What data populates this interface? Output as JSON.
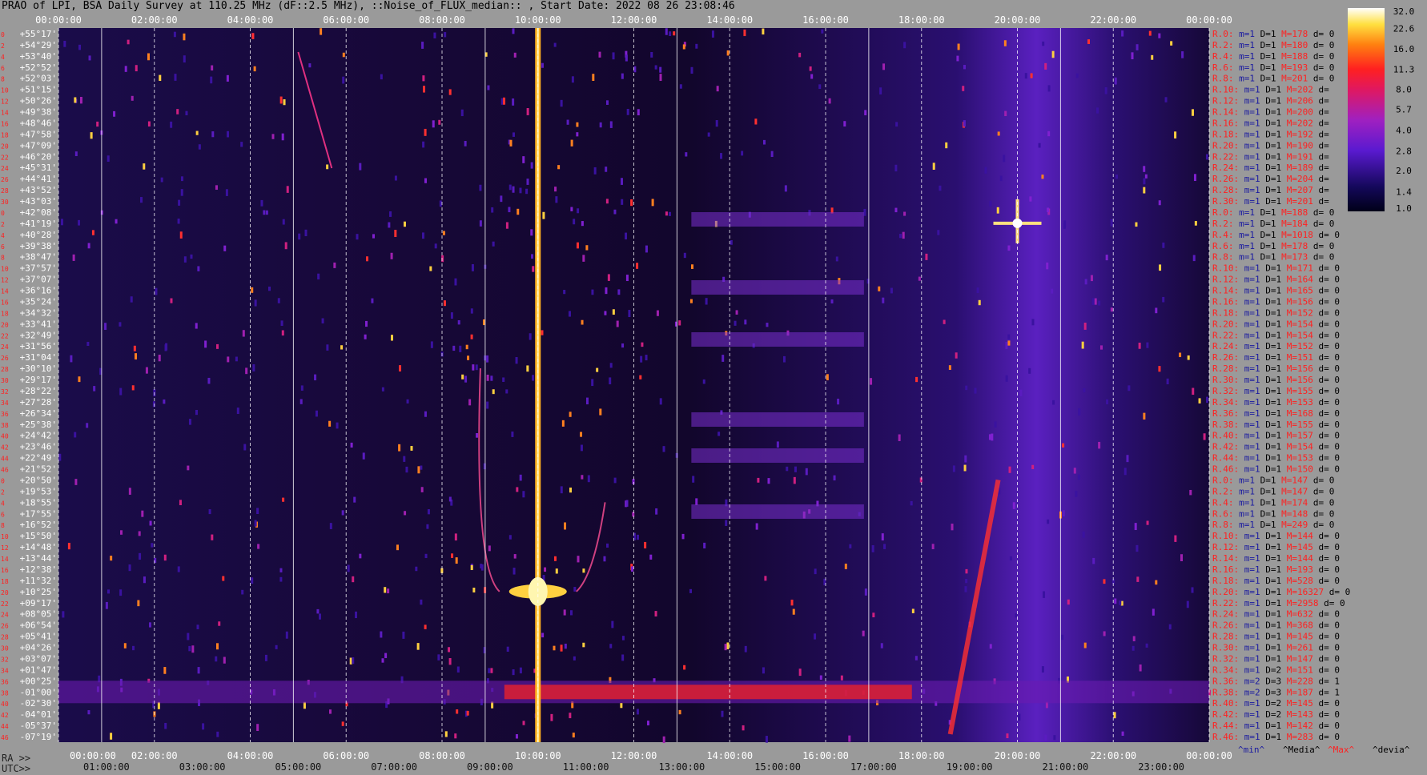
{
  "title": "PRAO of LPI, BSA Daily Survey at 110.25 MHz (dF::2.5 MHz), ::Noise_of_FLUX_median:: , Start Date: 2022 08 26 23:08:46",
  "footer": {
    "ra_label": "RA >>",
    "utc_label": "UTC>>"
  },
  "colors": {
    "background": "#9a9a9a",
    "plot_bg": "#1a0a40",
    "signal": "#ffd040",
    "label_red": "#ff2020",
    "label_blue": "#1a1aa0"
  },
  "chart_data": {
    "type": "heatmap",
    "title": "PRAO of LPI, BSA Daily Survey at 110.25 MHz (dF::2.5 MHz), ::Noise_of_FLUX_median:: , Start Date: 2022 08 26 23:08:46",
    "x_top_ticks": [
      "00:00:00",
      "02:00:00",
      "04:00:00",
      "06:00:00",
      "08:00:00",
      "10:00:00",
      "12:00:00",
      "14:00:00",
      "16:00:00",
      "18:00:00",
      "20:00:00",
      "22:00:00",
      "00:00:00"
    ],
    "x_bottom_ra_ticks": [
      "00:00:00",
      "02:00:00",
      "04:00:00",
      "06:00:00",
      "08:00:00",
      "10:00:00",
      "12:00:00",
      "14:00:00",
      "16:00:00",
      "18:00:00",
      "20:00:00",
      "22:00:00",
      "00:00:00"
    ],
    "x_bottom_utc_ticks": [
      "01:00:00",
      "03:00:00",
      "05:00:00",
      "07:00:00",
      "09:00:00",
      "11:00:00",
      "13:00:00",
      "15:00:00",
      "17:00:00",
      "19:00:00",
      "21:00:00",
      "23:00:00"
    ],
    "dec_labels": [
      "+55°17'",
      "+54°29'",
      "+53°40'",
      "+52°52'",
      "+52°03'",
      "+51°15'",
      "+50°26'",
      "+49°38'",
      "+48°46'",
      "+47°58'",
      "+47°09'",
      "+46°20'",
      "+45°31'",
      "+44°41'",
      "+43°52'",
      "+43°03'",
      "+42°08'",
      "+41°19'",
      "+40°28'",
      "+39°38'",
      "+38°47'",
      "+37°57'",
      "+37°07'",
      "+36°16'",
      "+35°24'",
      "+34°32'",
      "+33°41'",
      "+32°49'",
      "+31°56'",
      "+31°04'",
      "+30°10'",
      "+29°17'",
      "+28°22'",
      "+27°28'",
      "+26°34'",
      "+25°38'",
      "+24°42'",
      "+23°46'",
      "+22°49'",
      "+21°52'",
      "+20°50'",
      "+19°53'",
      "+18°55'",
      "+17°55'",
      "+16°52'",
      "+15°50'",
      "+14°48'",
      "+13°44'",
      "+12°38'",
      "+11°32'",
      "+10°25'",
      "+09°17'",
      "+08°05'",
      "+06°54'",
      "+05°41'",
      "+04°26'",
      "+03°07'",
      "+01°47'",
      "+00°25'",
      "-01°00'",
      "-02°30'",
      "-04°01'",
      "-05°37'",
      "-07°19'"
    ],
    "row_index_labels": [
      "0",
      "2",
      "4",
      "6",
      "8",
      "10",
      "12",
      "14",
      "16",
      "18",
      "20",
      "22",
      "24",
      "26",
      "28",
      "30",
      "0",
      "2",
      "4",
      "6",
      "8",
      "10",
      "12",
      "14",
      "16",
      "18",
      "20",
      "22",
      "24",
      "26",
      "28",
      "30",
      "32",
      "34",
      "36",
      "38",
      "40",
      "42",
      "44",
      "46",
      "0",
      "2",
      "4",
      "6",
      "8",
      "10",
      "12",
      "14",
      "16",
      "18",
      "20",
      "22",
      "24",
      "26",
      "28",
      "30",
      "32",
      "34",
      "36",
      "38",
      "40",
      "42",
      "44",
      "46"
    ],
    "row_stats": [
      {
        "r": "R.0:",
        "m": "m=1",
        "d": "D=1",
        "M": "M=178",
        "dv": "d= 0"
      },
      {
        "r": "R.2:",
        "m": "m=1",
        "d": "D=1",
        "M": "M=180",
        "dv": "d= 0"
      },
      {
        "r": "R.4:",
        "m": "m=1",
        "d": "D=1",
        "M": "M=188",
        "dv": "d= 0"
      },
      {
        "r": "R.6:",
        "m": "m=1",
        "d": "D=1",
        "M": "M=193",
        "dv": "d= 0"
      },
      {
        "r": "R.8:",
        "m": "m=1",
        "d": "D=1",
        "M": "M=201",
        "dv": "d= 0"
      },
      {
        "r": "R.10:",
        "m": "m=1",
        "d": "D=1",
        "M": "M=202",
        "dv": "d="
      },
      {
        "r": "R.12:",
        "m": "m=1",
        "d": "D=1",
        "M": "M=206",
        "dv": "d="
      },
      {
        "r": "R.14:",
        "m": "m=1",
        "d": "D=1",
        "M": "M=200",
        "dv": "d="
      },
      {
        "r": "R.16:",
        "m": "m=1",
        "d": "D=1",
        "M": "M=202",
        "dv": "d="
      },
      {
        "r": "R.18:",
        "m": "m=1",
        "d": "D=1",
        "M": "M=192",
        "dv": "d="
      },
      {
        "r": "R.20:",
        "m": "m=1",
        "d": "D=1",
        "M": "M=190",
        "dv": "d="
      },
      {
        "r": "R.22:",
        "m": "m=1",
        "d": "D=1",
        "M": "M=191",
        "dv": "d="
      },
      {
        "r": "R.24:",
        "m": "m=1",
        "d": "D=1",
        "M": "M=189",
        "dv": "d="
      },
      {
        "r": "R.26:",
        "m": "m=1",
        "d": "D=1",
        "M": "M=204",
        "dv": "d="
      },
      {
        "r": "R.28:",
        "m": "m=1",
        "d": "D=1",
        "M": "M=207",
        "dv": "d="
      },
      {
        "r": "R.30:",
        "m": "m=1",
        "d": "D=1",
        "M": "M=201",
        "dv": "d="
      },
      {
        "r": "R.0:",
        "m": "m=1",
        "d": "D=1",
        "M": "M=188",
        "dv": "d= 0"
      },
      {
        "r": "R.2:",
        "m": "m=1",
        "d": "D=1",
        "M": "M=184",
        "dv": "d= 0"
      },
      {
        "r": "R.4:",
        "m": "m=1",
        "d": "D=1",
        "M": "M=1018",
        "dv": "d= 0"
      },
      {
        "r": "R.6:",
        "m": "m=1",
        "d": "D=1",
        "M": "M=178",
        "dv": "d= 0"
      },
      {
        "r": "R.8:",
        "m": "m=1",
        "d": "D=1",
        "M": "M=173",
        "dv": "d= 0"
      },
      {
        "r": "R.10:",
        "m": "m=1",
        "d": "D=1",
        "M": "M=171",
        "dv": "d= 0"
      },
      {
        "r": "R.12:",
        "m": "m=1",
        "d": "D=1",
        "M": "M=164",
        "dv": "d= 0"
      },
      {
        "r": "R.14:",
        "m": "m=1",
        "d": "D=1",
        "M": "M=165",
        "dv": "d= 0"
      },
      {
        "r": "R.16:",
        "m": "m=1",
        "d": "D=1",
        "M": "M=156",
        "dv": "d= 0"
      },
      {
        "r": "R.18:",
        "m": "m=1",
        "d": "D=1",
        "M": "M=152",
        "dv": "d= 0"
      },
      {
        "r": "R.20:",
        "m": "m=1",
        "d": "D=1",
        "M": "M=154",
        "dv": "d= 0"
      },
      {
        "r": "R.22:",
        "m": "m=1",
        "d": "D=1",
        "M": "M=154",
        "dv": "d= 0"
      },
      {
        "r": "R.24:",
        "m": "m=1",
        "d": "D=1",
        "M": "M=152",
        "dv": "d= 0"
      },
      {
        "r": "R.26:",
        "m": "m=1",
        "d": "D=1",
        "M": "M=151",
        "dv": "d= 0"
      },
      {
        "r": "R.28:",
        "m": "m=1",
        "d": "D=1",
        "M": "M=156",
        "dv": "d= 0"
      },
      {
        "r": "R.30:",
        "m": "m=1",
        "d": "D=1",
        "M": "M=156",
        "dv": "d= 0"
      },
      {
        "r": "R.32:",
        "m": "m=1",
        "d": "D=1",
        "M": "M=155",
        "dv": "d= 0"
      },
      {
        "r": "R.34:",
        "m": "m=1",
        "d": "D=1",
        "M": "M=153",
        "dv": "d= 0"
      },
      {
        "r": "R.36:",
        "m": "m=1",
        "d": "D=1",
        "M": "M=168",
        "dv": "d= 0"
      },
      {
        "r": "R.38:",
        "m": "m=1",
        "d": "D=1",
        "M": "M=155",
        "dv": "d= 0"
      },
      {
        "r": "R.40:",
        "m": "m=1",
        "d": "D=1",
        "M": "M=157",
        "dv": "d= 0"
      },
      {
        "r": "R.42:",
        "m": "m=1",
        "d": "D=1",
        "M": "M=154",
        "dv": "d= 0"
      },
      {
        "r": "R.44:",
        "m": "m=1",
        "d": "D=1",
        "M": "M=153",
        "dv": "d= 0"
      },
      {
        "r": "R.46:",
        "m": "m=1",
        "d": "D=1",
        "M": "M=150",
        "dv": "d= 0"
      },
      {
        "r": "R.0:",
        "m": "m=1",
        "d": "D=1",
        "M": "M=147",
        "dv": "d= 0"
      },
      {
        "r": "R.2:",
        "m": "m=1",
        "d": "D=1",
        "M": "M=147",
        "dv": "d= 0"
      },
      {
        "r": "R.4:",
        "m": "m=1",
        "d": "D=1",
        "M": "M=174",
        "dv": "d= 0"
      },
      {
        "r": "R.6:",
        "m": "m=1",
        "d": "D=1",
        "M": "M=148",
        "dv": "d= 0"
      },
      {
        "r": "R.8:",
        "m": "m=1",
        "d": "D=1",
        "M": "M=249",
        "dv": "d= 0"
      },
      {
        "r": "R.10:",
        "m": "m=1",
        "d": "D=1",
        "M": "M=144",
        "dv": "d= 0"
      },
      {
        "r": "R.12:",
        "m": "m=1",
        "d": "D=1",
        "M": "M=145",
        "dv": "d= 0"
      },
      {
        "r": "R.14:",
        "m": "m=1",
        "d": "D=1",
        "M": "M=144",
        "dv": "d= 0"
      },
      {
        "r": "R.16:",
        "m": "m=1",
        "d": "D=1",
        "M": "M=193",
        "dv": "d= 0"
      },
      {
        "r": "R.18:",
        "m": "m=1",
        "d": "D=1",
        "M": "M=528",
        "dv": "d= 0"
      },
      {
        "r": "R.20:",
        "m": "m=1",
        "d": "D=1",
        "M": "M=16327",
        "dv": "d= 0"
      },
      {
        "r": "R.22:",
        "m": "m=1",
        "d": "D=1",
        "M": "M=2958",
        "dv": "d= 0"
      },
      {
        "r": "R.24:",
        "m": "m=1",
        "d": "D=1",
        "M": "M=632",
        "dv": "d= 0"
      },
      {
        "r": "R.26:",
        "m": "m=1",
        "d": "D=1",
        "M": "M=368",
        "dv": "d= 0"
      },
      {
        "r": "R.28:",
        "m": "m=1",
        "d": "D=1",
        "M": "M=145",
        "dv": "d= 0"
      },
      {
        "r": "R.30:",
        "m": "m=1",
        "d": "D=1",
        "M": "M=261",
        "dv": "d= 0"
      },
      {
        "r": "R.32:",
        "m": "m=1",
        "d": "D=1",
        "M": "M=147",
        "dv": "d= 0"
      },
      {
        "r": "R.34:",
        "m": "m=1",
        "d": "D=2",
        "M": "M=151",
        "dv": "d= 0"
      },
      {
        "r": "R.36:",
        "m": "m=2",
        "d": "D=3",
        "M": "M=228",
        "dv": "d= 1"
      },
      {
        "r": "R.38:",
        "m": "m=2",
        "d": "D=3",
        "M": "M=187",
        "dv": "d= 1"
      },
      {
        "r": "R.40:",
        "m": "m=1",
        "d": "D=2",
        "M": "M=145",
        "dv": "d= 0"
      },
      {
        "r": "R.42:",
        "m": "m=1",
        "d": "D=2",
        "M": "M=143",
        "dv": "d= 0"
      },
      {
        "r": "R.44:",
        "m": "m=1",
        "d": "D=1",
        "M": "M=142",
        "dv": "d= 0"
      },
      {
        "r": "R.46:",
        "m": "m=1",
        "d": "D=1",
        "M": "M=283",
        "dv": "d= 0"
      }
    ],
    "stats_legend": [
      "^min^",
      "^Media^",
      "^Max^",
      "^devia^"
    ],
    "colorbar": {
      "ticks": [
        "32.0",
        "22.6",
        "16.0",
        "11.3",
        "8.0",
        "5.7",
        "4.0",
        "2.8",
        "2.0",
        "1.4",
        "1.0"
      ],
      "scale": "log",
      "range": [
        1.0,
        32.0
      ]
    },
    "features": {
      "bright_vertical_source_ra_hours": 10.0,
      "bright_vertical_source_peak_dec": "+10°25'",
      "second_point_source_ra_hours": 20.0,
      "second_point_source_dec": "+41°19'",
      "horizontal_interference_dec": "-01°00'"
    }
  }
}
